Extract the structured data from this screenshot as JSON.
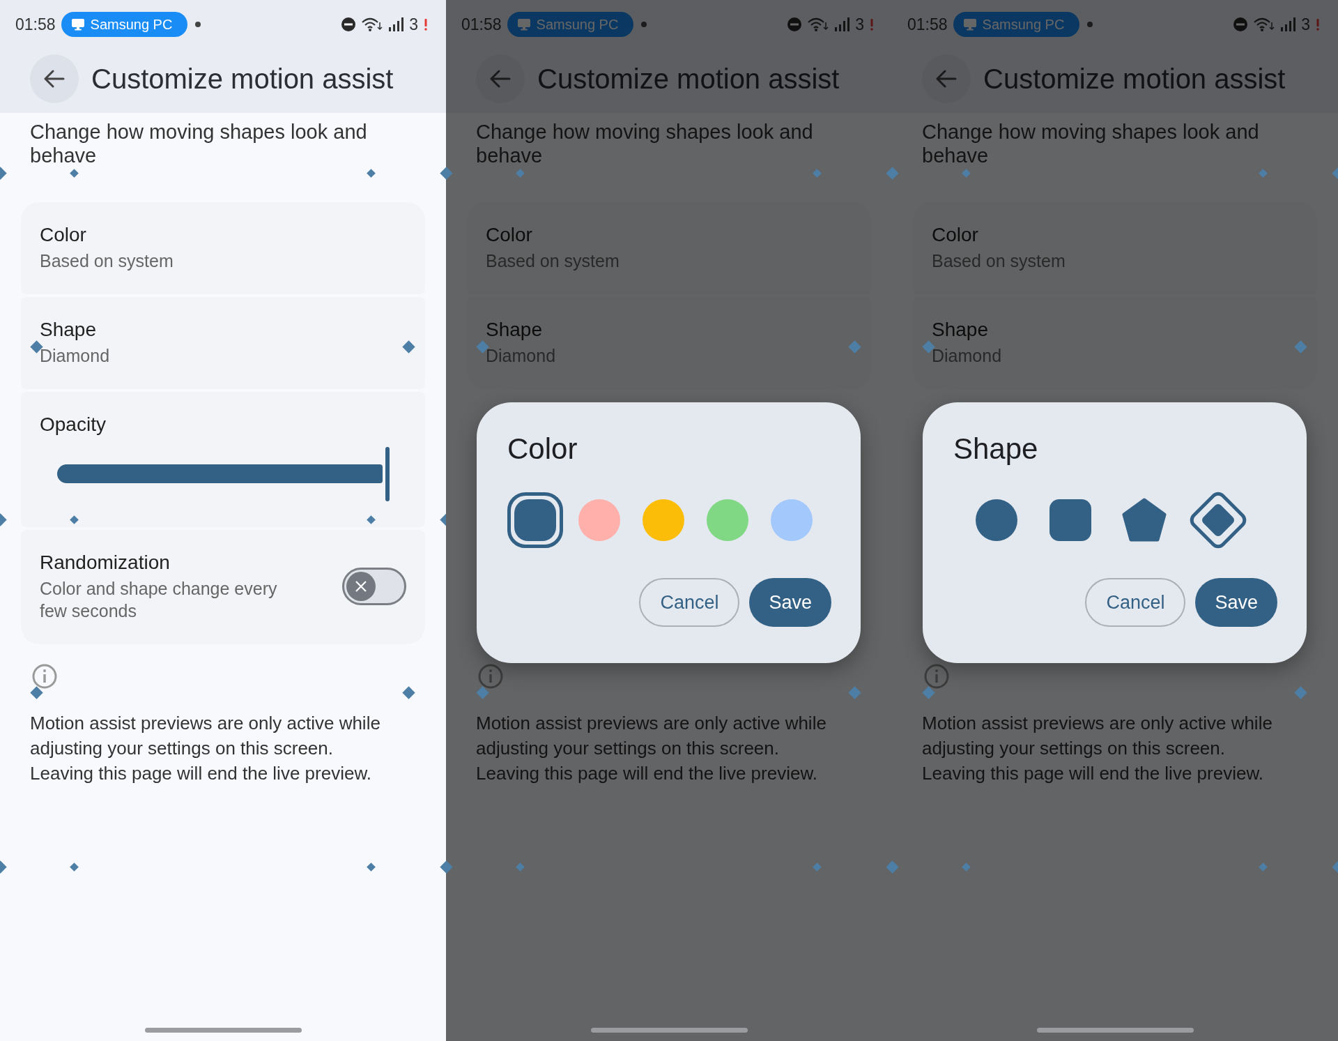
{
  "panels": [
    {
      "status_bar": {
        "time": "01:58",
        "chip": "Samsung PC",
        "network": "3"
      },
      "title": "Customize motion assist",
      "description": "Change how moving shapes look and behave",
      "settings": [
        {
          "kind": "value",
          "label": "Color",
          "value": "Based on system"
        },
        {
          "kind": "value",
          "label": "Shape",
          "value": "Diamond"
        },
        {
          "kind": "slider",
          "label": "Opacity",
          "level": 0.97
        },
        {
          "kind": "toggle",
          "label": "Randomization",
          "value": "Color and shape change every few seconds",
          "on": false
        }
      ],
      "footer": "Motion assist previews are only active while adjusting your settings on this screen. Leaving this page will end the live preview."
    },
    {
      "status_bar": {
        "time": "01:58",
        "chip": "Samsung PC",
        "network": "3"
      },
      "title": "Customize motion assist",
      "description": "Change how moving shapes look and behave",
      "settings": [
        {
          "kind": "value",
          "label": "Color",
          "value": "Based on system"
        },
        {
          "kind": "value",
          "label": "Shape",
          "value": "Diamond"
        }
      ],
      "footer": "Motion assist previews are only active while adjusting your settings on this screen. Leaving this page will end the live preview.",
      "dialog": {
        "title": "Color",
        "kind": "color",
        "options": [
          {
            "color": "#336185",
            "selected": true
          },
          {
            "color": "#ffb0ab",
            "selected": false
          },
          {
            "color": "#fbbd08",
            "selected": false
          },
          {
            "color": "#80d884",
            "selected": false
          },
          {
            "color": "#a3c8fc",
            "selected": false
          }
        ],
        "buttons": [
          {
            "label": "Cancel",
            "kind": "outline"
          },
          {
            "label": "Save",
            "kind": "filled"
          }
        ]
      }
    },
    {
      "status_bar": {
        "time": "01:58",
        "chip": "Samsung PC",
        "network": "3"
      },
      "title": "Customize motion assist",
      "description": "Change how moving shapes look and behave",
      "settings": [
        {
          "kind": "value",
          "label": "Color",
          "value": "Based on system"
        },
        {
          "kind": "value",
          "label": "Shape",
          "value": "Diamond"
        }
      ],
      "footer": "Motion assist previews are only active while adjusting your settings on this screen. Leaving this page will end the live preview.",
      "dialog": {
        "title": "Shape",
        "kind": "shape",
        "options": [
          {
            "kind": "circle",
            "selected": false
          },
          {
            "kind": "square",
            "selected": false
          },
          {
            "kind": "pentagon",
            "selected": false
          },
          {
            "kind": "diamond",
            "selected": true
          }
        ],
        "buttons": [
          {
            "label": "Cancel",
            "kind": "outline"
          },
          {
            "label": "Save",
            "kind": "filled"
          }
        ]
      }
    }
  ]
}
